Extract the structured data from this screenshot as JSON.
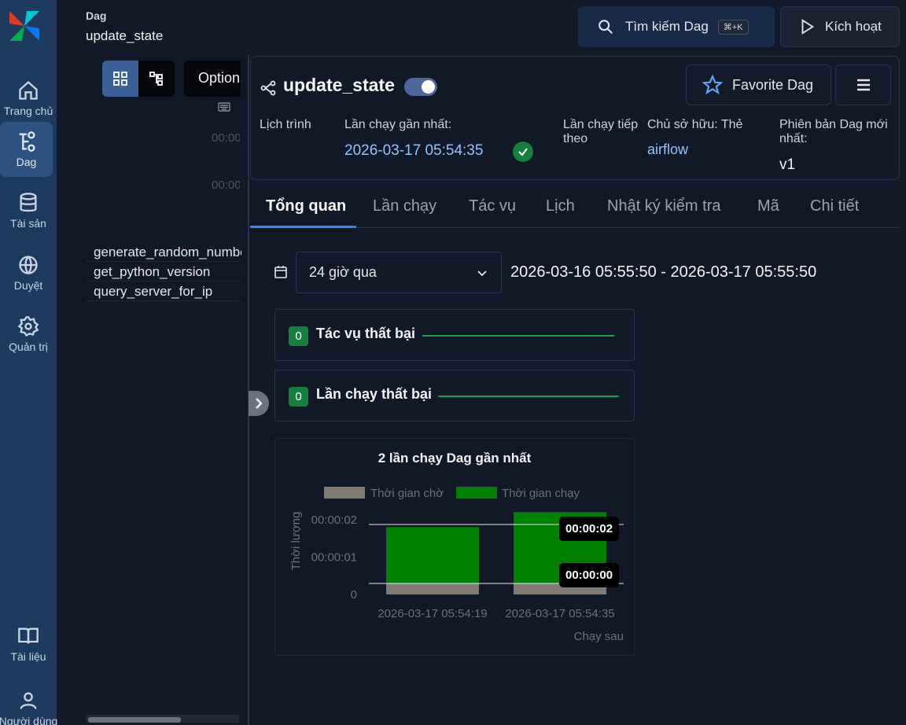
{
  "nav": {
    "items": [
      {
        "label": "Trang chủ",
        "icon": "home-icon"
      },
      {
        "label": "Dag",
        "icon": "dag-icon"
      },
      {
        "label": "Tài sản",
        "icon": "database-icon"
      },
      {
        "label": "Duyệt",
        "icon": "globe-icon"
      },
      {
        "label": "Quản trị",
        "icon": "gear-icon"
      },
      {
        "label": "Tài liệu",
        "icon": "book-icon"
      },
      {
        "label": "Người dùng",
        "icon": "user-icon"
      }
    ]
  },
  "breadcrumb": {
    "section": "Dag",
    "current": "update_state"
  },
  "topbar": {
    "search_label": "Tìm kiếm Dag",
    "search_shortcut": "⌘+K",
    "trigger_label": "Kích hoạt"
  },
  "left_panel": {
    "options_label": "Options",
    "time_ticks": [
      "00:00",
      "00:00"
    ],
    "tasks": [
      "generate_random_number",
      "get_python_version",
      "query_server_for_ip"
    ]
  },
  "dag": {
    "name": "update_state",
    "paused": false,
    "favorite_label": "Favorite Dag",
    "schedule_label": "Lịch trình",
    "last_run_label": "Lần chạy gần nhất:",
    "last_run_value": "2026-03-17 05:54:35",
    "last_run_state": "success",
    "next_run_label": "Lần chạy tiếp theo",
    "owner_label": "Chủ sở hữu: Thẻ",
    "owner_value": "airflow",
    "version_label": "Phiên bản Dag mới nhất:",
    "version_value": "v1"
  },
  "tabs": [
    {
      "label": "Tổng quan",
      "active": true
    },
    {
      "label": "Lần chạy",
      "active": false
    },
    {
      "label": "Tác vụ",
      "active": false
    },
    {
      "label": "Lịch",
      "active": false
    },
    {
      "label": "Nhật ký kiểm tra",
      "active": false
    },
    {
      "label": "Mã",
      "active": false
    },
    {
      "label": "Chi tiết",
      "active": false
    }
  ],
  "filter": {
    "range_selected": "24 giờ qua",
    "range_text": "2026-03-16 05:55:50 - 2026-03-17 05:55:50"
  },
  "stats": [
    {
      "count": "0",
      "label": "Tác vụ thất bại"
    },
    {
      "count": "0",
      "label": "Lần chạy thất bại"
    }
  ],
  "colors": {
    "queued": "#7f7b74",
    "running": "#008000",
    "success": "#15803d",
    "accent": "#3b82f6"
  },
  "chart_data": {
    "type": "bar",
    "stacked": true,
    "title": "2 lần chạy Dag gần nhất",
    "xlabel": "Chạy sau",
    "ylabel": "Thời lượng",
    "categories": [
      "2026-03-17 05:54:19",
      "2026-03-17 05:54:35"
    ],
    "series": [
      {
        "name": "Thời gian chờ",
        "values": [
          0.3,
          0.3
        ]
      },
      {
        "name": "Thời gian chạy",
        "values": [
          1.5,
          1.9
        ]
      }
    ],
    "y_ticks": [
      "0",
      "00:00:01",
      "00:00:02"
    ],
    "ylim": [
      0,
      2.1
    ],
    "tooltips": [
      "00:00:02",
      "00:00:00"
    ],
    "legend_position": "top",
    "grid": true
  }
}
